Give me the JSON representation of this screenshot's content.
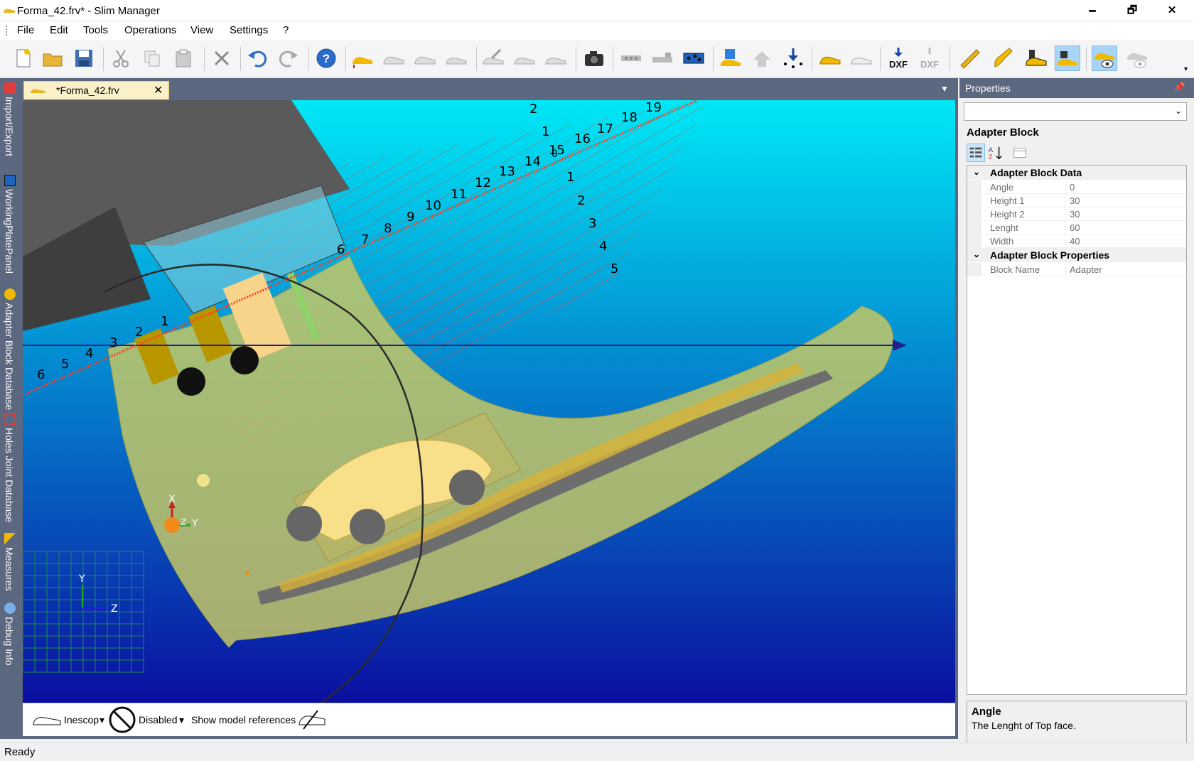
{
  "window": {
    "title": "Forma_42.frv* - Slim Manager",
    "minimize": "🗕",
    "restore": "🗗",
    "close": "✕"
  },
  "menu": [
    {
      "label": "File"
    },
    {
      "label": "Edit"
    },
    {
      "label": "Tools"
    },
    {
      "label": "Operations"
    },
    {
      "label": "View"
    },
    {
      "label": "Settings"
    },
    {
      "label": "?"
    }
  ],
  "toolbar": {
    "items": [
      "new-file-icon",
      "open-folder-icon",
      "save-icon",
      "cut-icon",
      "copy-icon",
      "paste-icon",
      "delete-icon",
      "undo-icon",
      "redo-icon",
      "help-icon",
      "last-yellow-icon",
      "last-outline-1-icon",
      "last-outline-2-icon",
      "last-outline-3-icon",
      "last-edit-1-icon",
      "last-edit-2-icon",
      "last-edit-3-icon",
      "camera-icon",
      "plate-1-icon",
      "plate-2-icon",
      "plate-holes-icon",
      "adapter-block-icon",
      "adapter-rotate-icon",
      "drill-down-icon",
      "last-yellow-2-icon",
      "last-white-icon",
      "dxf-export-icon",
      "dxf-import-icon",
      "ruler-icon",
      "insole-icon",
      "block-heel-icon",
      "block-heel-2-icon",
      "view-eye-yellow-icon",
      "view-eye-grey-icon"
    ],
    "dxf_label": "DXF"
  },
  "left_tabs": [
    {
      "label": "Import/Export",
      "icon": "import-export-icon"
    },
    {
      "label": "WorkingPlatePanel",
      "icon": "plate-panel-icon"
    },
    {
      "label": "Adapter Block Database",
      "icon": "adapter-database-icon"
    },
    {
      "label": "Holes Joint Database",
      "icon": "holes-database-icon"
    },
    {
      "label": "Measures",
      "icon": "measures-icon"
    },
    {
      "label": "Debug Info",
      "icon": "debug-icon"
    }
  ],
  "document": {
    "tab_label": "*Forma_42.frv",
    "close": "✕",
    "menu": "▼"
  },
  "viewport": {
    "scale_top_labels": [
      "2",
      "1",
      "15",
      "16",
      "17",
      "18",
      "19",
      "14",
      "13",
      "12",
      "11",
      "10",
      "9",
      "8",
      "7",
      "6"
    ],
    "scale_right_labels": [
      "1",
      "2",
      "3",
      "4",
      "5"
    ],
    "scale_bottom_labels": [
      "1",
      "2",
      "3",
      "4",
      "5",
      "6"
    ],
    "small_15_label": "0",
    "axis_main": {
      "x": "X",
      "y": "Y",
      "z": "Z"
    },
    "axis_mini": {
      "y": "Y",
      "z": "Z"
    },
    "colors": {
      "sky_top": "#00e5f4",
      "sky_bottom": "#0a0fa0",
      "last": "#c3c766",
      "adapter": "#5a5a5a"
    }
  },
  "status_strip": {
    "last_label": "Inescop",
    "mode_label": "Disabled",
    "references_label": "Show model references",
    "dropdown": "▾"
  },
  "properties": {
    "header": "Properties",
    "pin": "📌",
    "combo_arrow": "⌄",
    "object_name": "Adapter Block",
    "categories": [
      {
        "name": "Adapter Block Data",
        "rows": [
          {
            "name": "Angle",
            "value": "0"
          },
          {
            "name": "Height 1",
            "value": "30"
          },
          {
            "name": "Height 2",
            "value": "30"
          },
          {
            "name": "Lenght",
            "value": "60"
          },
          {
            "name": "Width",
            "value": "40"
          }
        ]
      },
      {
        "name": "Adapter Block Properties",
        "rows": [
          {
            "name": "Block Name",
            "value": "Adapter"
          }
        ]
      }
    ],
    "chevron": "⌄",
    "help_title": "Angle",
    "help_text": "The Lenght of Top face."
  },
  "status": {
    "text": "Ready"
  }
}
